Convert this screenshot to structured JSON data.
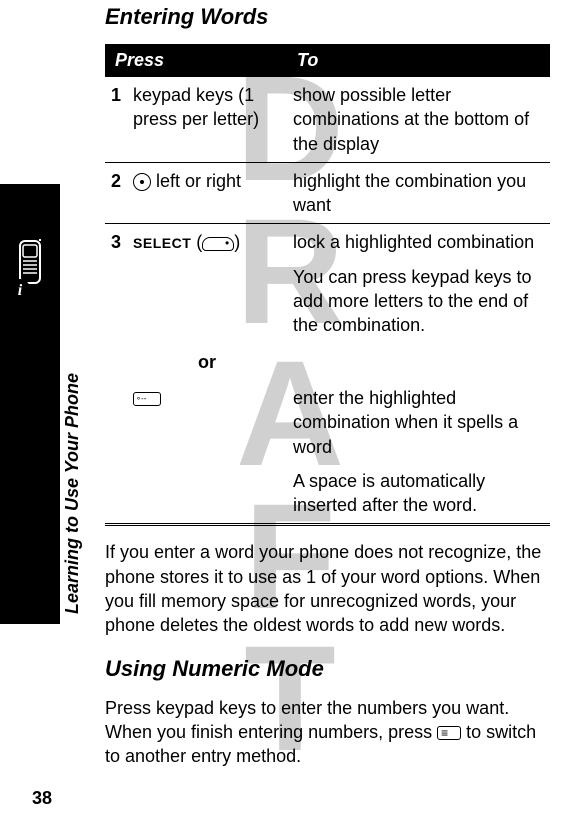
{
  "watermark": "DRAFT",
  "section_label": "Learning to Use Your Phone",
  "heading1": "Entering Words",
  "table": {
    "headers": {
      "press": "Press",
      "to": "To"
    },
    "rows": [
      {
        "num": "1",
        "press": "keypad keys (1 press per letter)",
        "to": "show possible letter combinations at the bottom of the display"
      },
      {
        "num": "2",
        "press_suffix": " left or right",
        "to": " highlight the combination you want"
      },
      {
        "num": "3",
        "press_label": "SELECT",
        "to1": "lock a highlighted combination",
        "to2": "You can press keypad keys to add more letters to the end of the combination.",
        "or": "or",
        "to3": "enter the highlighted combination when it spells a word",
        "to4": "A space is automatically inserted after the word."
      }
    ]
  },
  "body1": "If you enter a word your phone does not recognize, the phone stores it to use as 1 of your word options. When you fill memory space for unrecognized words, your phone deletes the oldest words to add new words.",
  "heading2": "Using Numeric Mode",
  "body2a": "Press keypad keys to enter the numbers you want. When you finish entering numbers, press ",
  "body2b": " to switch to another entry method.",
  "page_number": "38"
}
